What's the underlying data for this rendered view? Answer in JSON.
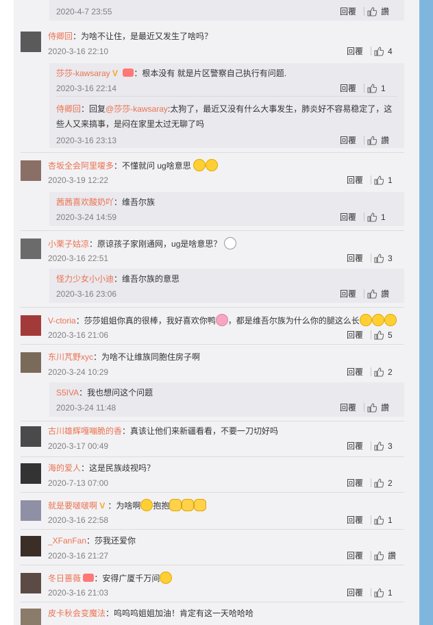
{
  "top_reply": {
    "time": "2020-4-7 23:55",
    "reply": "回覆",
    "like": "讚"
  },
  "comments": [
    {
      "user": "侍卿回",
      "text": "：为啥不让住，是最近又发生了啥吗？",
      "time": "2020-3-16 22:10",
      "reply": "回覆",
      "like": "4"
    },
    {
      "user": "莎莎-kawsaray",
      "text": "：根本没有 就是片区警察自己执行有问题.",
      "time": "2020-3-16 22:14",
      "reply": "回覆",
      "like": "1"
    },
    {
      "user": "侍卿回",
      "text_prefix": "：回复",
      "mention": "@莎莎-kawsaray",
      "text": ":太狗了，最近又没有什么大事发生，肺炎好不容易稳定了，这些人又来搞事，是闷在家里太过无聊了吗",
      "time": "2020-3-16 23:13",
      "reply": "回覆",
      "like": "讚"
    },
    {
      "user": "杏坂全会阿里嗄多",
      "text": "：不懂就问 ug啥意思",
      "time": "2020-3-19 12:22",
      "reply": "回覆",
      "like": "1"
    },
    {
      "user": "茜茜喜欢酸奶吖",
      "text": "：维吾尔族",
      "time": "2020-3-24 14:59",
      "reply": "回覆",
      "like": "1"
    },
    {
      "user": "小栗子姑凉",
      "text": "：原谅孩子家刚通网，ug是啥意思？",
      "time": "2020-3-16 22:51",
      "reply": "回覆",
      "like": "3"
    },
    {
      "user": "怪力少女小小迪",
      "text": "：维吾尔族的意思",
      "time": "2020-3-16 23:06",
      "reply": "回覆",
      "like": "讚"
    },
    {
      "user": "V-ctoria",
      "text_a": "：莎莎姐姐你真的很棒，我好喜欢你鸭",
      "text_b": "，都是维吾尔族为什么你的腿这么长",
      "time": "2020-3-16 21:06",
      "reply": "回覆",
      "like": "5"
    },
    {
      "user": "东川芃野xyc",
      "text": "：为啥不让维族同胞住房子啊",
      "time": "2020-3-24 10:29",
      "reply": "回覆",
      "like": "2"
    },
    {
      "user": "S5IVA",
      "text": "：我也想问这个问题",
      "time": "2020-3-24 11:48",
      "reply": "回覆",
      "like": "讚"
    },
    {
      "user": "古川雄辉嘎嘣脆的香",
      "text": "：真该让他们来新疆看看，不要一刀切好吗",
      "time": "2020-3-17 00:49",
      "reply": "回覆",
      "like": "3"
    },
    {
      "user": "海的爱人",
      "text": "：这是民族歧视吗？",
      "time": "2020-7-13 07:00",
      "reply": "回覆",
      "like": "2"
    },
    {
      "user": "就是要啵啵啊",
      "text_a": "：为啥啊",
      "text_b": "抱抱",
      "time": "2020-3-16 22:58",
      "reply": "回覆",
      "like": "1"
    },
    {
      "user": "_XFanFan",
      "text": "：莎我还爱你",
      "time": "2020-3-16 21:27",
      "reply": "回覆",
      "like": "讚"
    },
    {
      "user": "冬日蔷薇",
      "text": "：安得广厦千万间",
      "time": "2020-3-16 21:03",
      "reply": "回覆",
      "like": "1"
    },
    {
      "user": "皮卡秋会变魔法",
      "text": "：呜呜呜姐姐加油！肯定有这一天哈哈哈",
      "time": "",
      "reply": "",
      "like": ""
    }
  ],
  "colors": {
    "username": "#eb7350",
    "side_strip": "#7fb6dd",
    "panel": "#f2f2f5",
    "reply_box": "#e9e9ee"
  },
  "icons": {
    "like": "thumbs-up-icon",
    "verified": "v-badge-icon",
    "medal": "fan-medal-icon"
  }
}
